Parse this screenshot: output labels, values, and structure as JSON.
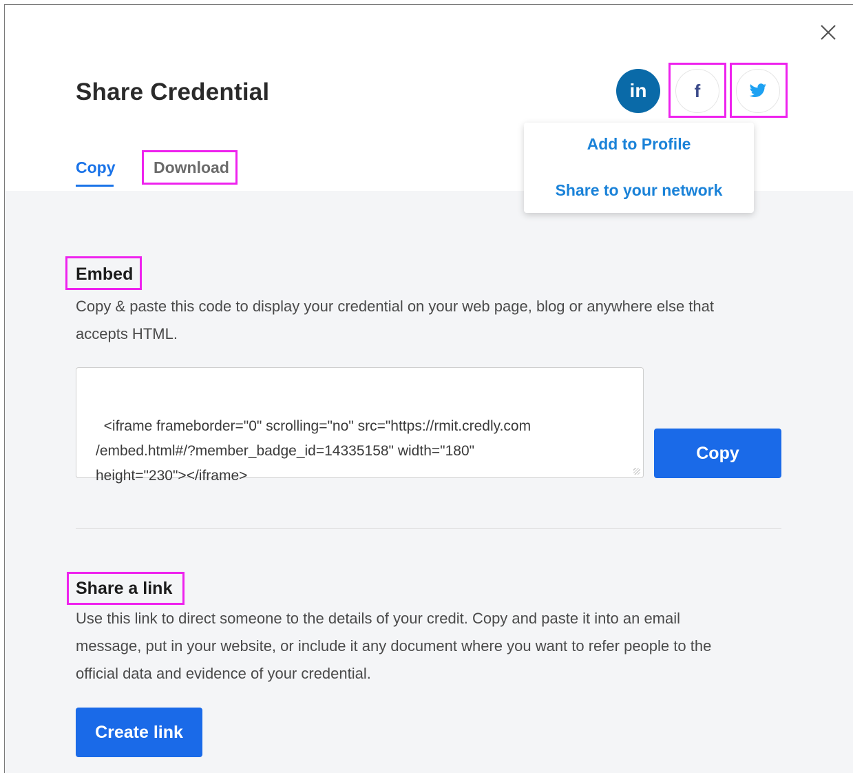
{
  "modal": {
    "title": "Share Credential",
    "close_icon": "close-icon"
  },
  "social": {
    "linkedin_label": "in",
    "facebook_label": "f",
    "twitter_icon": "twitter-bird-icon"
  },
  "linkedin_menu": {
    "items": [
      {
        "label": "Add to Profile"
      },
      {
        "label": "Share to your network"
      }
    ]
  },
  "tabs": [
    {
      "label": "Copy",
      "active": true
    },
    {
      "label": "Download",
      "active": false
    }
  ],
  "embed": {
    "heading": "Embed",
    "description_line1": "Copy & paste this code to display your credential on your web page, blog or anywhere else that",
    "description_line2": "accepts HTML.",
    "code": "<iframe frameborder=\"0\" scrolling=\"no\" src=\"https://rmit.credly.com\n/embed.html#/?member_badge_id=14335158\" width=\"180\"\nheight=\"230\"></iframe>",
    "copy_button": "Copy"
  },
  "share_link": {
    "heading": "Share a link",
    "description_line1": "Use this link to direct someone to the details of your credit. Copy and paste it into an email",
    "description_line2": "message, put in your website, or include it any document where you want to refer people to the",
    "description_line3": "official data and evidence of your credential.",
    "create_button": "Create link"
  },
  "colors": {
    "accent": "#1a6ae8",
    "link": "#1a82d8",
    "linkedin": "#0a6aa8",
    "highlight": "#ee22ee",
    "content_bg": "#f4f5f7"
  }
}
